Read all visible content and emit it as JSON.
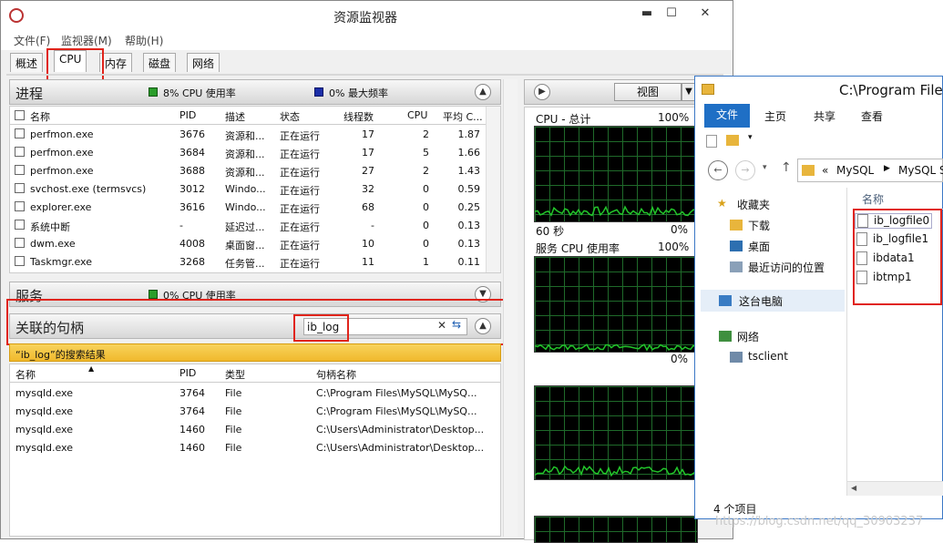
{
  "rm": {
    "title": "资源监视器",
    "win_min": "▬",
    "win_max": "☐",
    "win_close": "✕",
    "menu": [
      "文件(F)",
      "监视器(M)",
      "帮助(H)"
    ],
    "tabs": [
      "概述",
      "CPU",
      "内存",
      "磁盘",
      "网络"
    ],
    "processes": {
      "title": "进程",
      "cpu_usage": "8% CPU 使用率",
      "max_freq": "0% 最大频率",
      "columns": [
        "名称",
        "PID",
        "描述",
        "状态",
        "线程数",
        "CPU",
        "平均 C..."
      ],
      "rows": [
        [
          "perfmon.exe",
          "3676",
          "资源和...",
          "正在运行",
          "17",
          "2",
          "1.87"
        ],
        [
          "perfmon.exe",
          "3684",
          "资源和...",
          "正在运行",
          "17",
          "5",
          "1.66"
        ],
        [
          "perfmon.exe",
          "3688",
          "资源和...",
          "正在运行",
          "27",
          "2",
          "1.43"
        ],
        [
          "svchost.exe (termsvcs)",
          "3012",
          "Windo...",
          "正在运行",
          "32",
          "0",
          "0.59"
        ],
        [
          "explorer.exe",
          "3616",
          "Windo...",
          "正在运行",
          "68",
          "0",
          "0.25"
        ],
        [
          "系统中断",
          "-",
          "延迟过...",
          "正在运行",
          "-",
          "0",
          "0.13"
        ],
        [
          "dwm.exe",
          "4008",
          "桌面窗...",
          "正在运行",
          "10",
          "0",
          "0.13"
        ],
        [
          "Taskmgr.exe",
          "3268",
          "任务管...",
          "正在运行",
          "11",
          "1",
          "0.11"
        ]
      ]
    },
    "services": {
      "title": "服务",
      "cpu_usage": "0% CPU 使用率"
    },
    "handles": {
      "title": "关联的句柄",
      "search_value": "ib_log",
      "result_banner": "“ib_log”的搜索结果",
      "columns": [
        "名称",
        "PID",
        "类型",
        "句柄名称"
      ],
      "rows": [
        [
          "mysqld.exe",
          "3764",
          "File",
          "C:\\Program Files\\MySQL\\MySQ..."
        ],
        [
          "mysqld.exe",
          "3764",
          "File",
          "C:\\Program Files\\MySQL\\MySQ..."
        ],
        [
          "mysqld.exe",
          "1460",
          "File",
          "C:\\Users\\Administrator\\Desktop..."
        ],
        [
          "mysqld.exe",
          "1460",
          "File",
          "C:\\Users\\Administrator\\Desktop..."
        ]
      ]
    },
    "graphs": {
      "view_button": "视图",
      "cpu_total_label": "CPU - 总计",
      "cpu_total_max": "100%",
      "seconds": "60 秒",
      "cpu_total_min": "0%",
      "service_cpu_label": "服务 CPU 使用率",
      "service_cpu_max": "100%",
      "service_cpu_min": "0%"
    }
  },
  "explorer": {
    "title": "C:\\Program Files",
    "ribbon_tabs": [
      "文件",
      "主页",
      "共享",
      "查看"
    ],
    "address": {
      "sep": "«",
      "crumbs": [
        "MySQL",
        "MySQL S"
      ]
    },
    "nav": {
      "favorites": "收藏夹",
      "downloads": "下载",
      "desktop": "桌面",
      "recent": "最近访问的位置",
      "this_pc": "这台电脑",
      "network": "网络",
      "tsclient": "tsclient"
    },
    "column_name": "名称",
    "files": [
      "ib_logfile0",
      "ib_logfile1",
      "ibdata1",
      "ibtmp1"
    ],
    "status": "4 个项目"
  },
  "watermark": "https://blog.csdn.net/qq_30903237",
  "colors": {
    "accent_red": "#e0241b",
    "banner_yellow": "#f5c842",
    "graph_green": "#22c52a",
    "explorer_blue": "#1f6fc5"
  }
}
